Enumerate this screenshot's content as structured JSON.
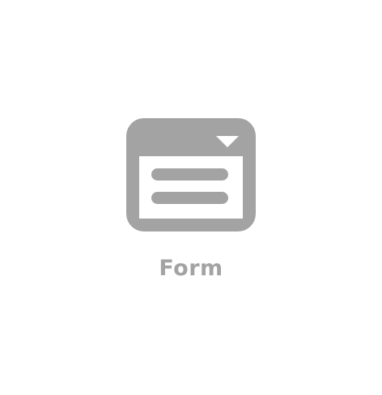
{
  "widget": {
    "icon": "form-window-icon",
    "label": "Form",
    "icon_color": "#a3a3a3",
    "label_color": "#a3a3a3",
    "background": "#ffffff"
  }
}
